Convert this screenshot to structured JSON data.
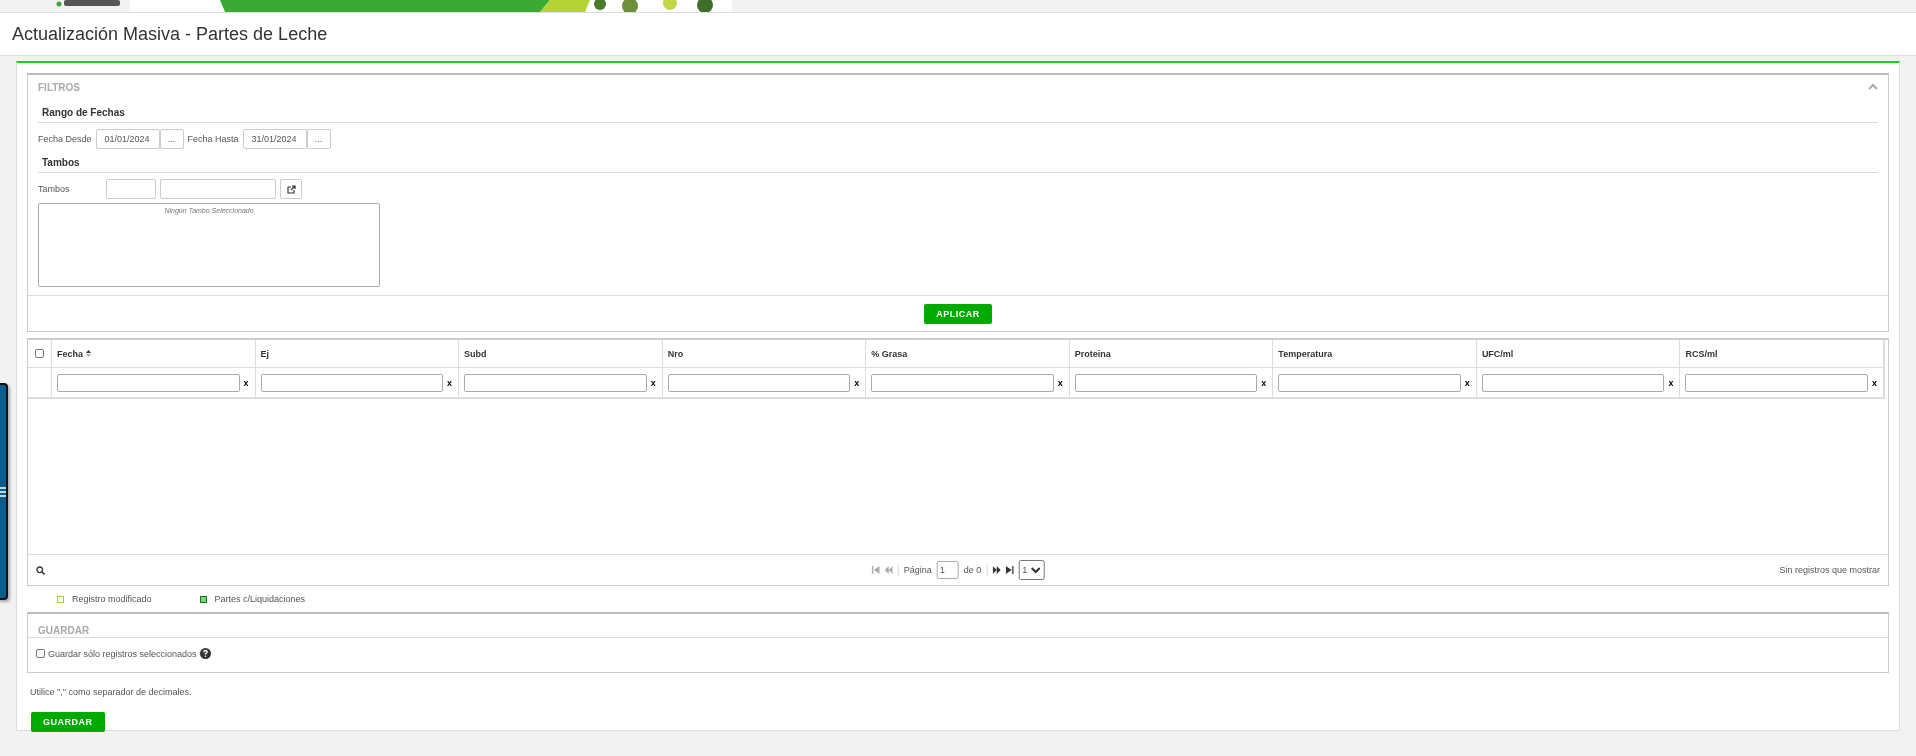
{
  "header": {
    "title": "Actualización Masiva - Partes de Leche"
  },
  "filters": {
    "title": "FILTROS",
    "expanded": true,
    "date_section": "Rango de Fechas",
    "date_fields": [
      {
        "label": "Fecha Desde",
        "value": "01/01/2024",
        "button": "..."
      },
      {
        "label": "Fecha Hasta",
        "value": "31/01/2024",
        "button": "..."
      }
    ],
    "tambos_section": "Tambos",
    "tambos_label": "Tambos",
    "selection_placeholder": "Ningún Tambo Seleccionado",
    "apply_button": "APLICAR"
  },
  "table": {
    "select_all_checked": false,
    "columns": [
      {
        "label": "Fecha",
        "sorted": true,
        "clear": "x"
      },
      {
        "label": "Ej",
        "sorted": false,
        "clear": "x"
      },
      {
        "label": "Subd",
        "sorted": false,
        "clear": "x"
      },
      {
        "label": "Nro",
        "sorted": false,
        "clear": "x"
      },
      {
        "label": "% Grasa",
        "sorted": false,
        "clear": "x"
      },
      {
        "label": "Proteina",
        "sorted": false,
        "clear": "x"
      },
      {
        "label": "Temperatura",
        "sorted": false,
        "clear": "x"
      },
      {
        "label": "UFC/ml",
        "sorted": false,
        "clear": "x"
      },
      {
        "label": "RCS/ml",
        "sorted": false,
        "clear": "x"
      }
    ],
    "footer": {
      "page_label": "Página",
      "page_value": "1",
      "page_total": "de 0",
      "page_size": "1",
      "status": "Sin registros que mostrar"
    }
  },
  "legend": [
    {
      "label": "Registro modificado",
      "color": "#a6ce39",
      "filled": false
    },
    {
      "label": "Partes c/Liquidaciones",
      "color": "#1f6b1f",
      "filled": true
    }
  ],
  "save_panel": {
    "title": "GUARDAR",
    "checkbox": {
      "label": "Guardar sólo registros seleccionados",
      "checked": false
    }
  },
  "note": "Utilice \",\" como separador de decimales.",
  "save_button": "GUARDAR"
}
